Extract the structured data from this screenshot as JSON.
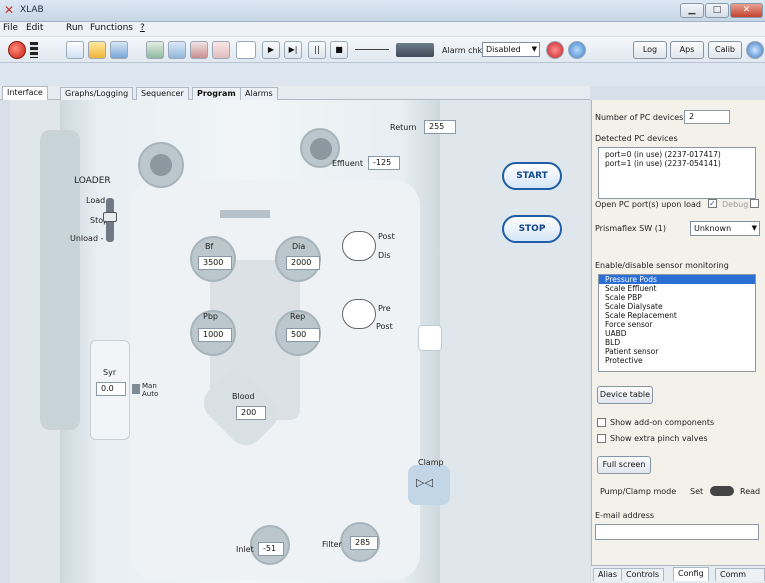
{
  "window": {
    "title": "XLAB",
    "min": "▁",
    "max": "□",
    "close": "✕"
  },
  "menu": {
    "file": "File",
    "edit": "Edit",
    "run": "Run",
    "functions": "Functions",
    "help": "?"
  },
  "toolbar": {
    "alarm_label": "Alarm chk:",
    "alarm_value": "Disabled",
    "log": "Log",
    "aps": "Aps",
    "calib": "Calib"
  },
  "tabs": [
    "Interface",
    "Graphs/Logging",
    "Sequencer",
    "Program",
    "Alarms"
  ],
  "machine": {
    "return_label": "Return",
    "return_value": "255",
    "effluent_label": "Effluent",
    "effluent_value": "-125",
    "loader_title": "LOADER",
    "loader_load": "Load -",
    "loader_stop": "Stop -",
    "loader_unload": "Unload -",
    "bf_label": "Bf",
    "bf_value": "3500",
    "dia_label": "Dia",
    "dia_value": "2000",
    "post_label": "Post",
    "dis_label": "Dis",
    "pbp_label": "Pbp",
    "pbp_value": "1000",
    "rep_label": "Rep",
    "rep_value": "500",
    "pre_label": "Pre",
    "post2_label": "Post",
    "syr_label": "Syr",
    "syr_value": "0.0",
    "man_label": "Man",
    "auto_label": "Auto",
    "blood_label": "Blood",
    "blood_value": "200",
    "clamp_label": "Clamp",
    "inlet_label": "Inlet",
    "inlet_value": "-51",
    "filter_label": "Filter",
    "filter_value": "285",
    "start": "START",
    "stop": "STOP"
  },
  "config": {
    "num_pc_label": "Number of PC devices",
    "num_pc_value": "2",
    "detected_label": "Detected PC devices",
    "devices": [
      "port=0  (in use) (2237-017417)",
      "port=1  (in use) (2237-054141)"
    ],
    "open_ports_label": "Open PC port(s) upon load",
    "debug_label": "Debug",
    "prismaflex_label": "Prismaflex SW (1)",
    "prismaflex_value": "Unknown",
    "enable_label": "Enable/disable sensor monitoring",
    "sensors": [
      "Pressure Pods",
      "Scale Effluent",
      "Scale PBP",
      "Scale Dialysate",
      "Scale Replacement",
      "Force sensor",
      "UABD",
      "BLD",
      "Patient sensor",
      "Protective"
    ],
    "device_table": "Device table",
    "show_addon": "Show add-on components",
    "show_pinch": "Show extra pinch valves",
    "full_screen": "Full screen",
    "pump_clamp_label": "Pump/Clamp mode",
    "set_label": "Set",
    "read_label": "Read",
    "email_label": "E-mail address",
    "email_value": ""
  },
  "bottom_tabs": [
    "Alias",
    "Controls",
    "Config",
    "Comm log"
  ]
}
